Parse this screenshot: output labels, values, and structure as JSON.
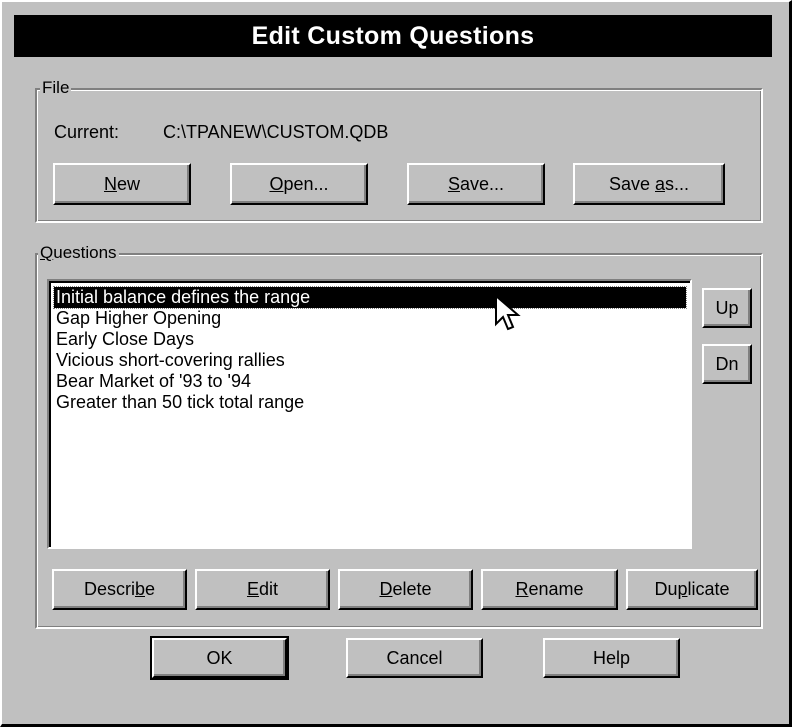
{
  "dialog": {
    "title": "Edit Custom Questions"
  },
  "file_group": {
    "label": "File",
    "current_label": "Current:",
    "current_path": "C:\\TPANEW\\CUSTOM.QDB",
    "buttons": {
      "new": {
        "pre": "",
        "key": "N",
        "post": "ew"
      },
      "open": {
        "pre": "",
        "key": "O",
        "post": "pen..."
      },
      "save": {
        "pre": "",
        "key": "S",
        "post": "ave..."
      },
      "save_as": {
        "pre": "Save ",
        "key": "a",
        "post": "s..."
      }
    }
  },
  "questions_group": {
    "label_key": "Q",
    "label_rest": "uestions",
    "items": [
      "Initial balance defines the range",
      "Gap Higher Opening",
      "Early Close Days",
      "Vicious short-covering rallies",
      "Bear Market of '93 to '94",
      "Greater than 50 tick total range"
    ],
    "selected_index": 0,
    "up_label": "Up",
    "dn_label": "Dn",
    "buttons": {
      "describe": {
        "pre": "Descri",
        "key": "b",
        "post": "e"
      },
      "edit": {
        "pre": "",
        "key": "E",
        "post": "dit"
      },
      "delete": {
        "pre": "",
        "key": "D",
        "post": "elete"
      },
      "rename": {
        "pre": "",
        "key": "R",
        "post": "ename"
      },
      "duplicate": {
        "pre": "Du",
        "key": "p",
        "post": "licate"
      }
    }
  },
  "footer": {
    "ok_label": "OK",
    "cancel_label": "Cancel",
    "help_label": "Help"
  },
  "icons": {
    "cursor": "arrow-pointer-icon"
  }
}
